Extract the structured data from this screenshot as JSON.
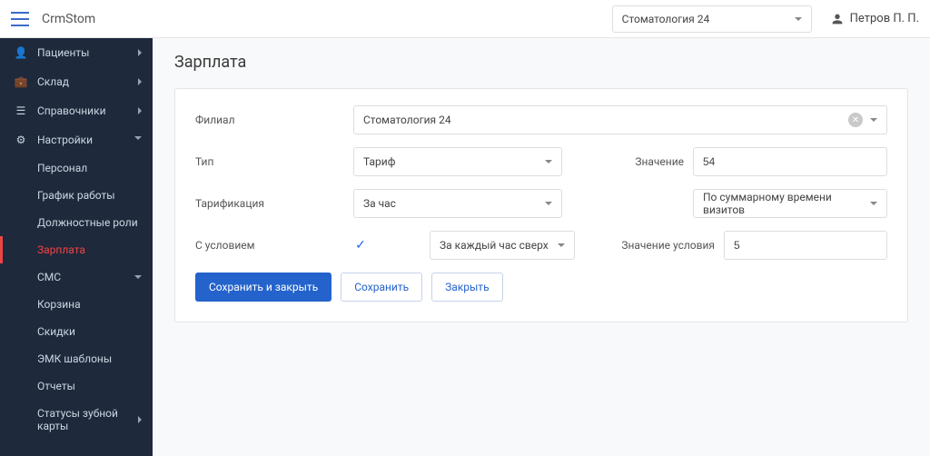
{
  "header": {
    "brand": "CrmStom",
    "org": "Стоматология 24",
    "user": "Петров П. П."
  },
  "sidebar": {
    "items": [
      {
        "label": "Пациенты"
      },
      {
        "label": "Склад"
      },
      {
        "label": "Справочники"
      },
      {
        "label": "Настройки"
      }
    ],
    "subs": [
      {
        "label": "Персонал"
      },
      {
        "label": "График работы"
      },
      {
        "label": "Должностные роли"
      },
      {
        "label": "Зарплата"
      },
      {
        "label": "СМС"
      },
      {
        "label": "Корзина"
      },
      {
        "label": "Скидки"
      },
      {
        "label": "ЭМК шаблоны"
      },
      {
        "label": "Отчеты"
      },
      {
        "label": "Статусы зубной карты"
      }
    ]
  },
  "page": {
    "title": "Зарплата",
    "filialLabel": "Филиал",
    "filialValue": "Стоматология 24",
    "typeLabel": "Тип",
    "typeValue": "Тариф",
    "valueLabel": "Значение",
    "valueValue": "54",
    "tarifLabel": "Тарификация",
    "tarifValue": "За час",
    "tarifMethod": "По суммарному времени визитов",
    "condLabel": "С условием",
    "condPer": "За каждый час сверх",
    "condValLabel": "Значение условия",
    "condValValue": "5",
    "buttons": {
      "saveClose": "Сохранить и закрыть",
      "save": "Сохранить",
      "close": "Закрыть"
    }
  }
}
